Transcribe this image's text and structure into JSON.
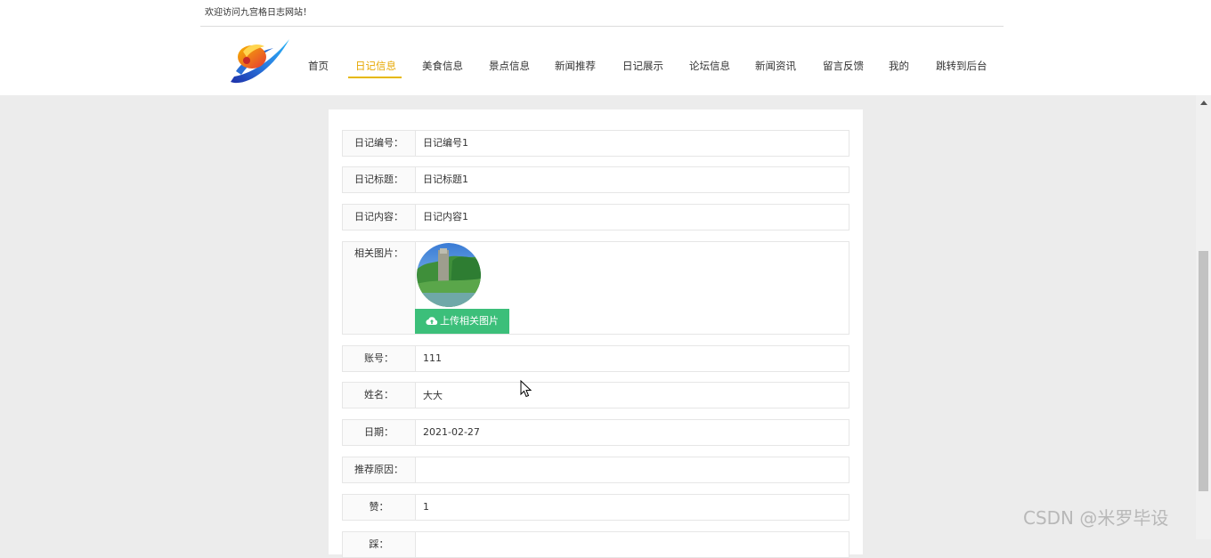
{
  "header": {
    "welcome": "欢迎访问九宫格日志网站！",
    "nav": [
      {
        "label": "首页",
        "active": false
      },
      {
        "label": "日记信息",
        "active": true
      },
      {
        "label": "美食信息",
        "active": false
      },
      {
        "label": "景点信息",
        "active": false
      },
      {
        "label": "新闻推荐",
        "active": false
      },
      {
        "label": "日记展示",
        "active": false
      },
      {
        "label": "论坛信息",
        "active": false
      },
      {
        "label": "新闻资讯",
        "active": false
      },
      {
        "label": "留言反馈",
        "active": false
      },
      {
        "label": "我的",
        "active": false
      },
      {
        "label": "跳转到后台",
        "active": false
      }
    ],
    "accent_color": "#e6a700"
  },
  "form": {
    "fields": [
      {
        "label": "日记编号：",
        "value": "日记编号1"
      },
      {
        "label": "日记标题：",
        "value": "日记标题1"
      },
      {
        "label": "日记内容：",
        "value": "日记内容1"
      },
      {
        "label": "相关图片：",
        "value": ""
      },
      {
        "label": "账号：",
        "value": "111"
      },
      {
        "label": "姓名：",
        "value": "大大"
      },
      {
        "label": "日期：",
        "value": "2021-02-27"
      },
      {
        "label": "推荐原因：",
        "value": ""
      },
      {
        "label": "赞：",
        "value": "1"
      },
      {
        "label": "踩：",
        "value": ""
      }
    ],
    "upload_button": "上传相关图片",
    "upload_icon": "cloud-upload-icon",
    "button_color": "#3cbf7a"
  },
  "watermark": "CSDN @米罗毕设"
}
